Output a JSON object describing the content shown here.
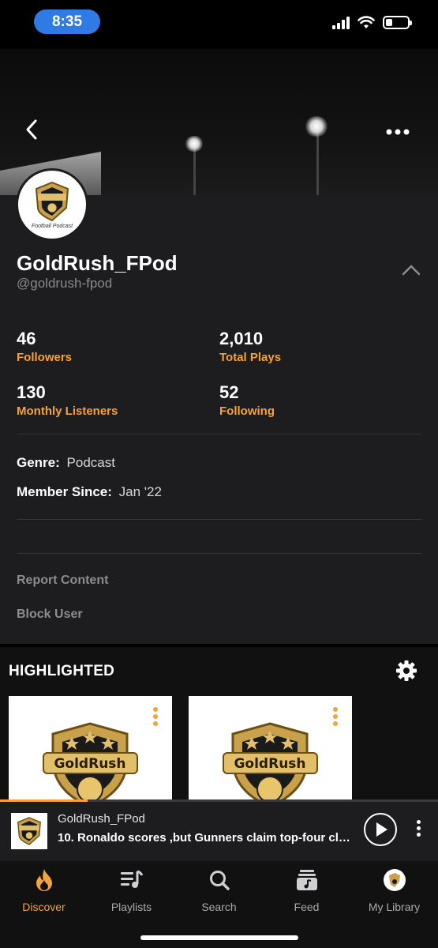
{
  "status_bar": {
    "time": "8:35"
  },
  "profile": {
    "name": "GoldRush_FPod",
    "handle": "@goldrush-fpod",
    "avatar_caption": "Football Podcast",
    "stats": [
      {
        "value": "46",
        "label": "Followers"
      },
      {
        "value": "2,010",
        "label": "Total Plays"
      },
      {
        "value": "130",
        "label": "Monthly Listeners"
      },
      {
        "value": "52",
        "label": "Following"
      }
    ],
    "genre_label": "Genre:",
    "genre_value": "Podcast",
    "member_label": "Member Since:",
    "member_value": "Jan '22",
    "report_label": "Report Content",
    "block_label": "Block User"
  },
  "highlighted": {
    "title": "HIGHLIGHTED",
    "card_logo_text": "GoldRush"
  },
  "player": {
    "artist": "GoldRush_FPod",
    "title": "10. Ronaldo scores ,but Gunners claim top-four cla...",
    "progress": 0.2
  },
  "tabs": [
    {
      "label": "Discover",
      "icon": "flame-icon",
      "active": true
    },
    {
      "label": "Playlists",
      "icon": "playlist-icon",
      "active": false
    },
    {
      "label": "Search",
      "icon": "search-icon",
      "active": false
    },
    {
      "label": "Feed",
      "icon": "feed-icon",
      "active": false
    },
    {
      "label": "My Library",
      "icon": "avatar-icon",
      "active": false
    }
  ],
  "colors": {
    "accent": "#f4a339",
    "panel": "#1d1d1f",
    "status_pill": "#2f7ae5"
  }
}
